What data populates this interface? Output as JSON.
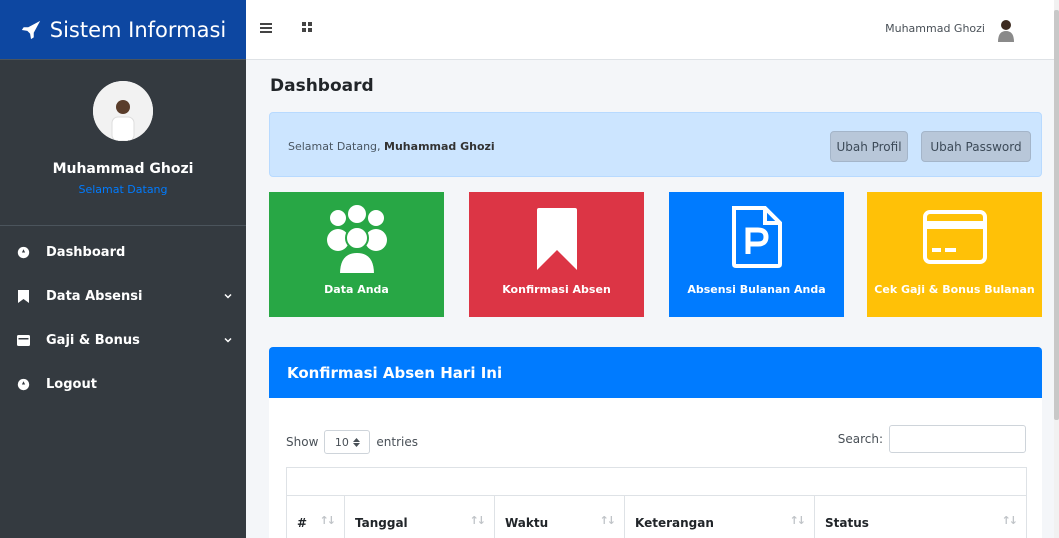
{
  "sidebar": {
    "brand": "Sistem Informasi",
    "user_name": "Muhammad Ghozi",
    "user_sub": "Selamat Datang",
    "items": [
      {
        "label": "Dashboard"
      },
      {
        "label": "Data Absensi"
      },
      {
        "label": "Gaji & Bonus"
      },
      {
        "label": "Logout"
      }
    ]
  },
  "topbar": {
    "user_name": "Muhammad Ghozi"
  },
  "page": {
    "title": "Dashboard"
  },
  "welcome": {
    "prefix": "Selamat Datang, ",
    "name": "Muhammad Ghozi",
    "btn_profile": "Ubah Profil",
    "btn_password": "Ubah Password"
  },
  "cards": [
    {
      "label": "Data Anda",
      "color": "#28a745",
      "icon": "users-icon"
    },
    {
      "label": "Konfirmasi Absen",
      "color": "#dc3545",
      "icon": "bookmark-icon"
    },
    {
      "label": "Absensi Bulanan Anda",
      "color": "#007bff",
      "icon": "file-p-icon"
    },
    {
      "label": "Cek Gaji & Bonus Bulanan",
      "color": "#ffc107",
      "icon": "credit-card-icon"
    }
  ],
  "panel": {
    "title": "Konfirmasi Absen Hari Ini",
    "show_label": "Show",
    "entries_value": "10",
    "entries_label": "entries",
    "search_label": "Search:",
    "columns": [
      "#",
      "Tanggal",
      "Waktu",
      "Keterangan",
      "Status"
    ]
  },
  "colors": {
    "sidebar_bg": "#343a40",
    "brand_bg": "#0d47a1",
    "primary": "#007bff"
  }
}
